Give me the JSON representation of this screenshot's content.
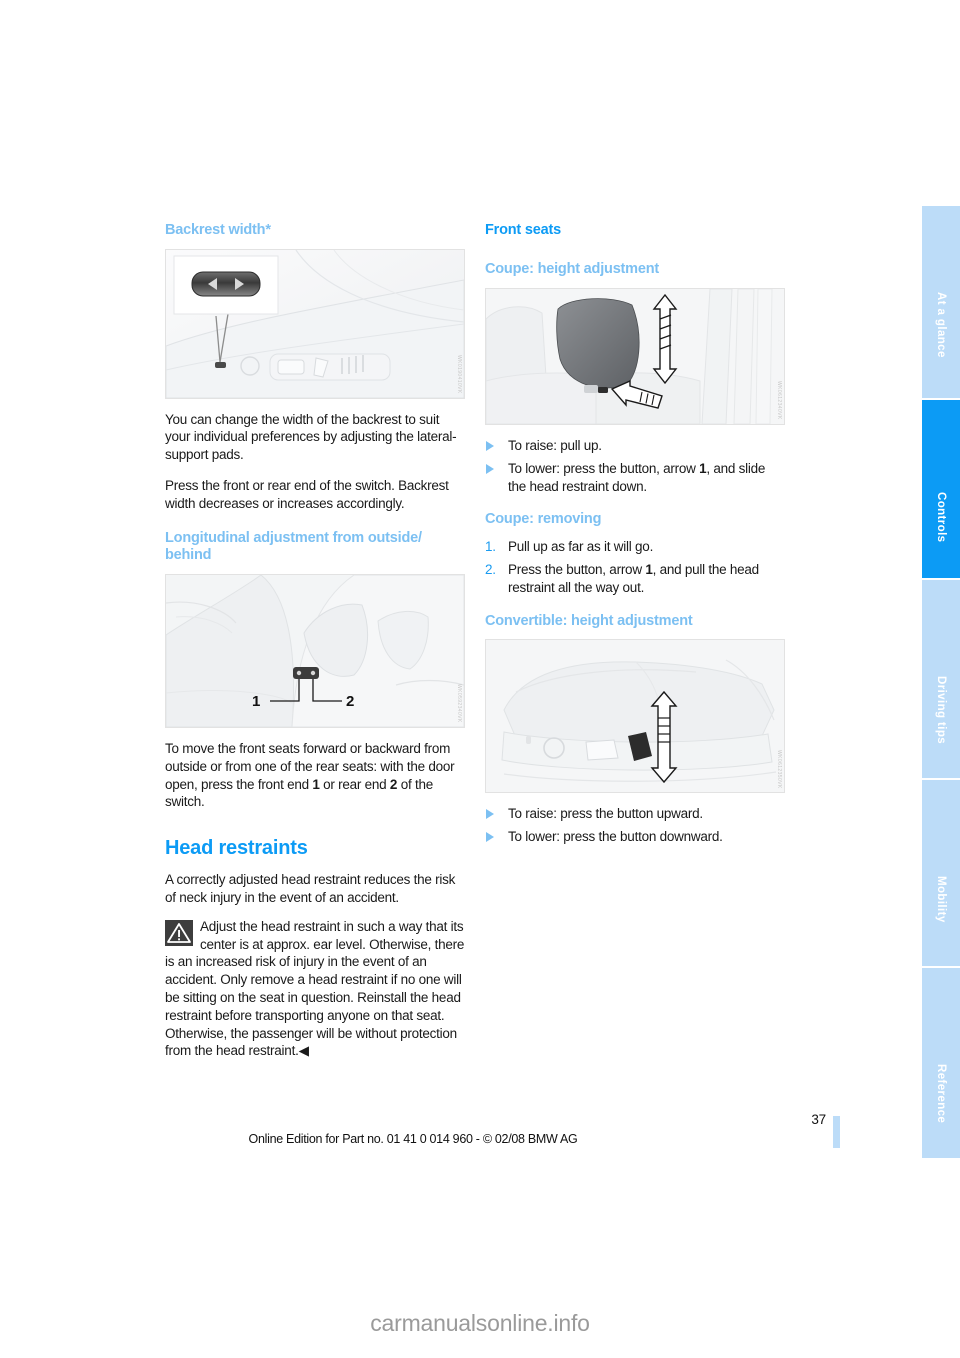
{
  "document": {
    "page_number": "37",
    "footer_line": "Online Edition for Part no. 01 41 0 014 960 - © 02/08 BMW AG",
    "site_watermark": "carmanualsonline.info"
  },
  "colors": {
    "heading_primary": "#0c9bf5",
    "heading_secondary": "#7cc0f2",
    "tab_inactive": "#bcdcf8",
    "tab_active": "#0c9bf5",
    "body_text": "#1a1a1a"
  },
  "rail": {
    "tabs": [
      {
        "label": "At a glance",
        "active": false
      },
      {
        "label": "Controls",
        "active": true
      },
      {
        "label": "Driving tips",
        "active": false
      },
      {
        "label": "Mobility",
        "active": false
      },
      {
        "label": "Reference",
        "active": false
      }
    ]
  },
  "left_column": {
    "backrest": {
      "heading": "Backrest width*",
      "figure": {
        "name": "backrest-width-switch-illustration",
        "watermark": "WK0190410VK",
        "inset_switch": {
          "left_arrow": "◀",
          "right_arrow": "▶"
        }
      },
      "paragraph_1": "You can change the width of the backrest to suit your individual preferences by adjusting the lateral-support pads.",
      "paragraph_2": "Press the front or rear end of the switch. Backrest width decreases or increases accordingly."
    },
    "longitudinal": {
      "heading": "Longitudinal adjustment from outside/ behind",
      "figure": {
        "name": "longitudinal-adjustment-switch-illustration",
        "watermark": "WK0592340VK",
        "callout_1": "1",
        "callout_2": "2"
      },
      "paragraph_parts": {
        "a": "To move the front seats forward or backward from outside or from one of the rear seats: with the door open, press the front end ",
        "b": "1",
        "c": " or rear end ",
        "d": "2",
        "e": " of the switch."
      }
    },
    "head_restraints": {
      "heading": "Head restraints",
      "paragraph_1": "A correctly adjusted head restraint reduces the risk of neck injury in the event of an accident.",
      "warning": {
        "icon": "warning-triangle-icon",
        "text": "Adjust the head restraint in such a way that its center is at approx. ear level. Otherwise, there is an increased risk of injury in the event of an accident. Only remove a head restraint if no one will be sitting on the seat in question. Reinstall the head restraint before transporting anyone on that seat. Otherwise, the passenger will be without protection from the head restraint.",
        "end_marker": "◀"
      }
    }
  },
  "right_column": {
    "front_seats": {
      "heading": "Front seats"
    },
    "coupe_height": {
      "heading": "Coupe: height adjustment",
      "figure": {
        "name": "coupe-head-restraint-illustration",
        "watermark": "WK0612340VK"
      },
      "bullets": [
        {
          "parts": {
            "a": "To raise: pull up.",
            "b": "",
            "c": ""
          }
        },
        {
          "parts": {
            "a": "To lower: press the button, arrow ",
            "b": "1",
            "c": ", and slide the head restraint down."
          }
        }
      ]
    },
    "coupe_removing": {
      "heading": "Coupe: removing",
      "steps": [
        {
          "index": "1.",
          "parts": {
            "a": "Pull up as far as it will go.",
            "b": "",
            "c": ""
          }
        },
        {
          "index": "2.",
          "parts": {
            "a": "Press the button, arrow ",
            "b": "1",
            "c": ", and pull the head restraint all the way out."
          }
        }
      ]
    },
    "convertible_height": {
      "heading": "Convertible: height adjustment",
      "figure": {
        "name": "convertible-seat-switch-illustration",
        "watermark": "WK0612350VK"
      },
      "bullets": [
        {
          "text": "To raise: press the button upward."
        },
        {
          "text": "To lower: press the button downward."
        }
      ]
    }
  }
}
